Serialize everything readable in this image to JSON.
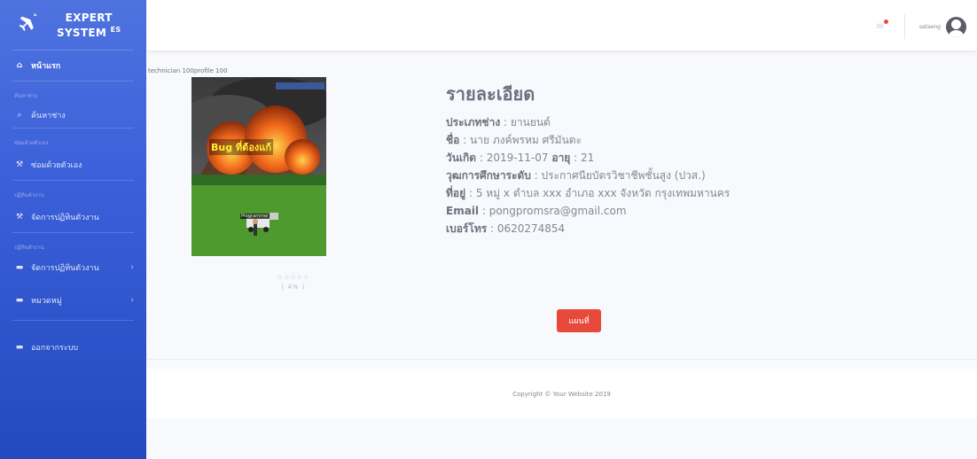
{
  "brand": {
    "line1": "EXPERT",
    "line2": "SYSTEM",
    "suffix": "ES"
  },
  "sidebar": {
    "home": "หน้าแรก",
    "sections": [
      {
        "heading": "ค้นหาช่าง",
        "item": "ค้นหาช่าง"
      },
      {
        "heading": "ซ่อมด้วยตัวเอง",
        "item": "ซ่อมด้วยตัวเอง"
      },
      {
        "heading": "ปฏิทินตัวงาน",
        "item": "จัดการปฏิทินตัวงาน"
      },
      {
        "heading": "ปฏิทินตัวงาน",
        "item": "จัดการปฏิทินตัวงาน"
      }
    ],
    "category": "หมวดหมู่",
    "logout": "ออกจากระบบ"
  },
  "topbar": {
    "username": "sataeng"
  },
  "profile": {
    "image_alt": "technician 100profile 100",
    "image_caption": "Bug ที่ต้องแก้",
    "image_label": "Programmer",
    "rating_stars": "☆☆☆☆☆",
    "rating_percent": "( 4% )"
  },
  "details": {
    "title": "รายละเอียด",
    "type_label": "ประเภทช่าง",
    "type_value": "ยานยนต์",
    "name_label": "ชื่อ",
    "name_value": "นาย ภงค์พรหม ศรีมันตะ",
    "birth_label": "วันเกิด",
    "birth_value": "2019-11-07",
    "age_label": "อายุ",
    "age_value": "21",
    "edu_label": "วุฒการศึกษาระดับ",
    "edu_value": "ประกาศนียบัตรวิชาชีพชั้นสูง (ปวส.)",
    "address_label": "ที่อยู่",
    "address_value": "5 หมู่ x ตำบล xxx อำเภอ xxx จังหวัด กรุงเทพมหานคร",
    "email_label": "Email",
    "email_value": "pongpromsra@gmail.com",
    "phone_label": "เบอร์โทร",
    "phone_value": "0620274854"
  },
  "map_button": "แผนที่",
  "footer": "Copyright © Your Website 2019",
  "colors": {
    "sidebar": "#4e73df",
    "accent": "#e74a3b"
  }
}
